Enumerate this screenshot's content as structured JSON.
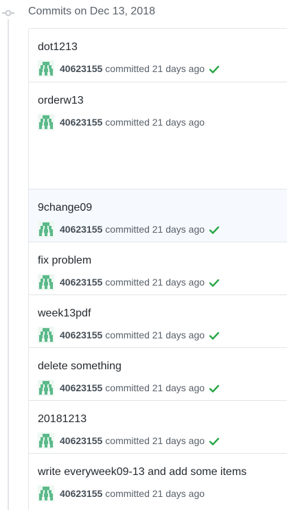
{
  "header": {
    "title": "Commits on Dec 13, 2018"
  },
  "colors": {
    "check": "#28a745",
    "avatar": "#5cb98a",
    "border": "#e1e4e8"
  },
  "commits": [
    {
      "message": "dot1213",
      "author": "40623155",
      "meta": "committed 21 days ago",
      "status": "success-check-icon"
    },
    {
      "message": "orderw13",
      "author": "40623155",
      "meta": "committed 21 days ago",
      "status": ""
    },
    {
      "message": "9change09",
      "author": "40623155",
      "meta": "committed 21 days ago",
      "status": "success-check-icon"
    },
    {
      "message": "fix problem",
      "author": "40623155",
      "meta": "committed 21 days ago",
      "status": "success-check-icon"
    },
    {
      "message": "week13pdf",
      "author": "40623155",
      "meta": "committed 21 days ago",
      "status": "success-check-icon"
    },
    {
      "message": "delete something",
      "author": "40623155",
      "meta": "committed 21 days ago",
      "status": "success-check-icon"
    },
    {
      "message": "20181213",
      "author": "40623155",
      "meta": "committed 21 days ago",
      "status": "success-check-icon"
    },
    {
      "message": "write everyweek09-13 and add some items",
      "author": "40623155",
      "meta": "committed 21 days ago",
      "status": ""
    }
  ]
}
